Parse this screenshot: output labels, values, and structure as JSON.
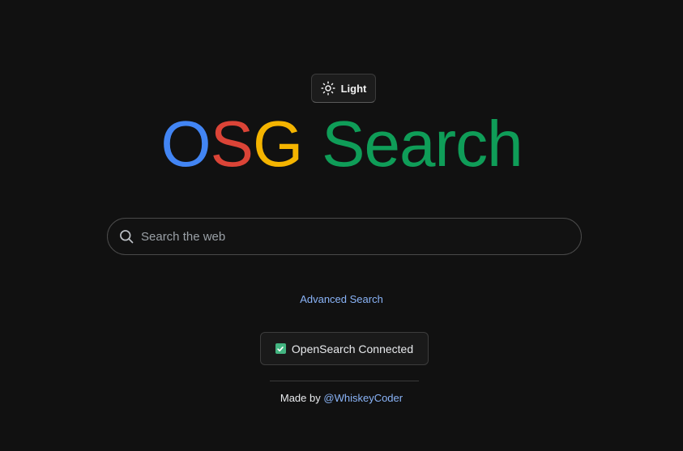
{
  "theme_toggle": {
    "label": "Light",
    "icon": "sun-icon"
  },
  "logo": {
    "letters": [
      {
        "text": "O",
        "color": "#4285f4"
      },
      {
        "text": "S",
        "color": "#db4437"
      },
      {
        "text": "G",
        "color": "#f4b400"
      }
    ],
    "word": {
      "text": "Search",
      "color": "#0f9d58"
    }
  },
  "search": {
    "placeholder": "Search the web",
    "value": "",
    "icon": "search-icon"
  },
  "advanced_search": {
    "label": "Advanced Search",
    "color": "#8ab4f8"
  },
  "status": {
    "text": "OpenSearch Connected",
    "icon": "check-icon",
    "icon_color": "#43b581"
  },
  "footer": {
    "prefix": "Made by",
    "author": "@WhiskeyCoder"
  },
  "colors": {
    "background": "#111111",
    "link": "#8ab4f8"
  }
}
